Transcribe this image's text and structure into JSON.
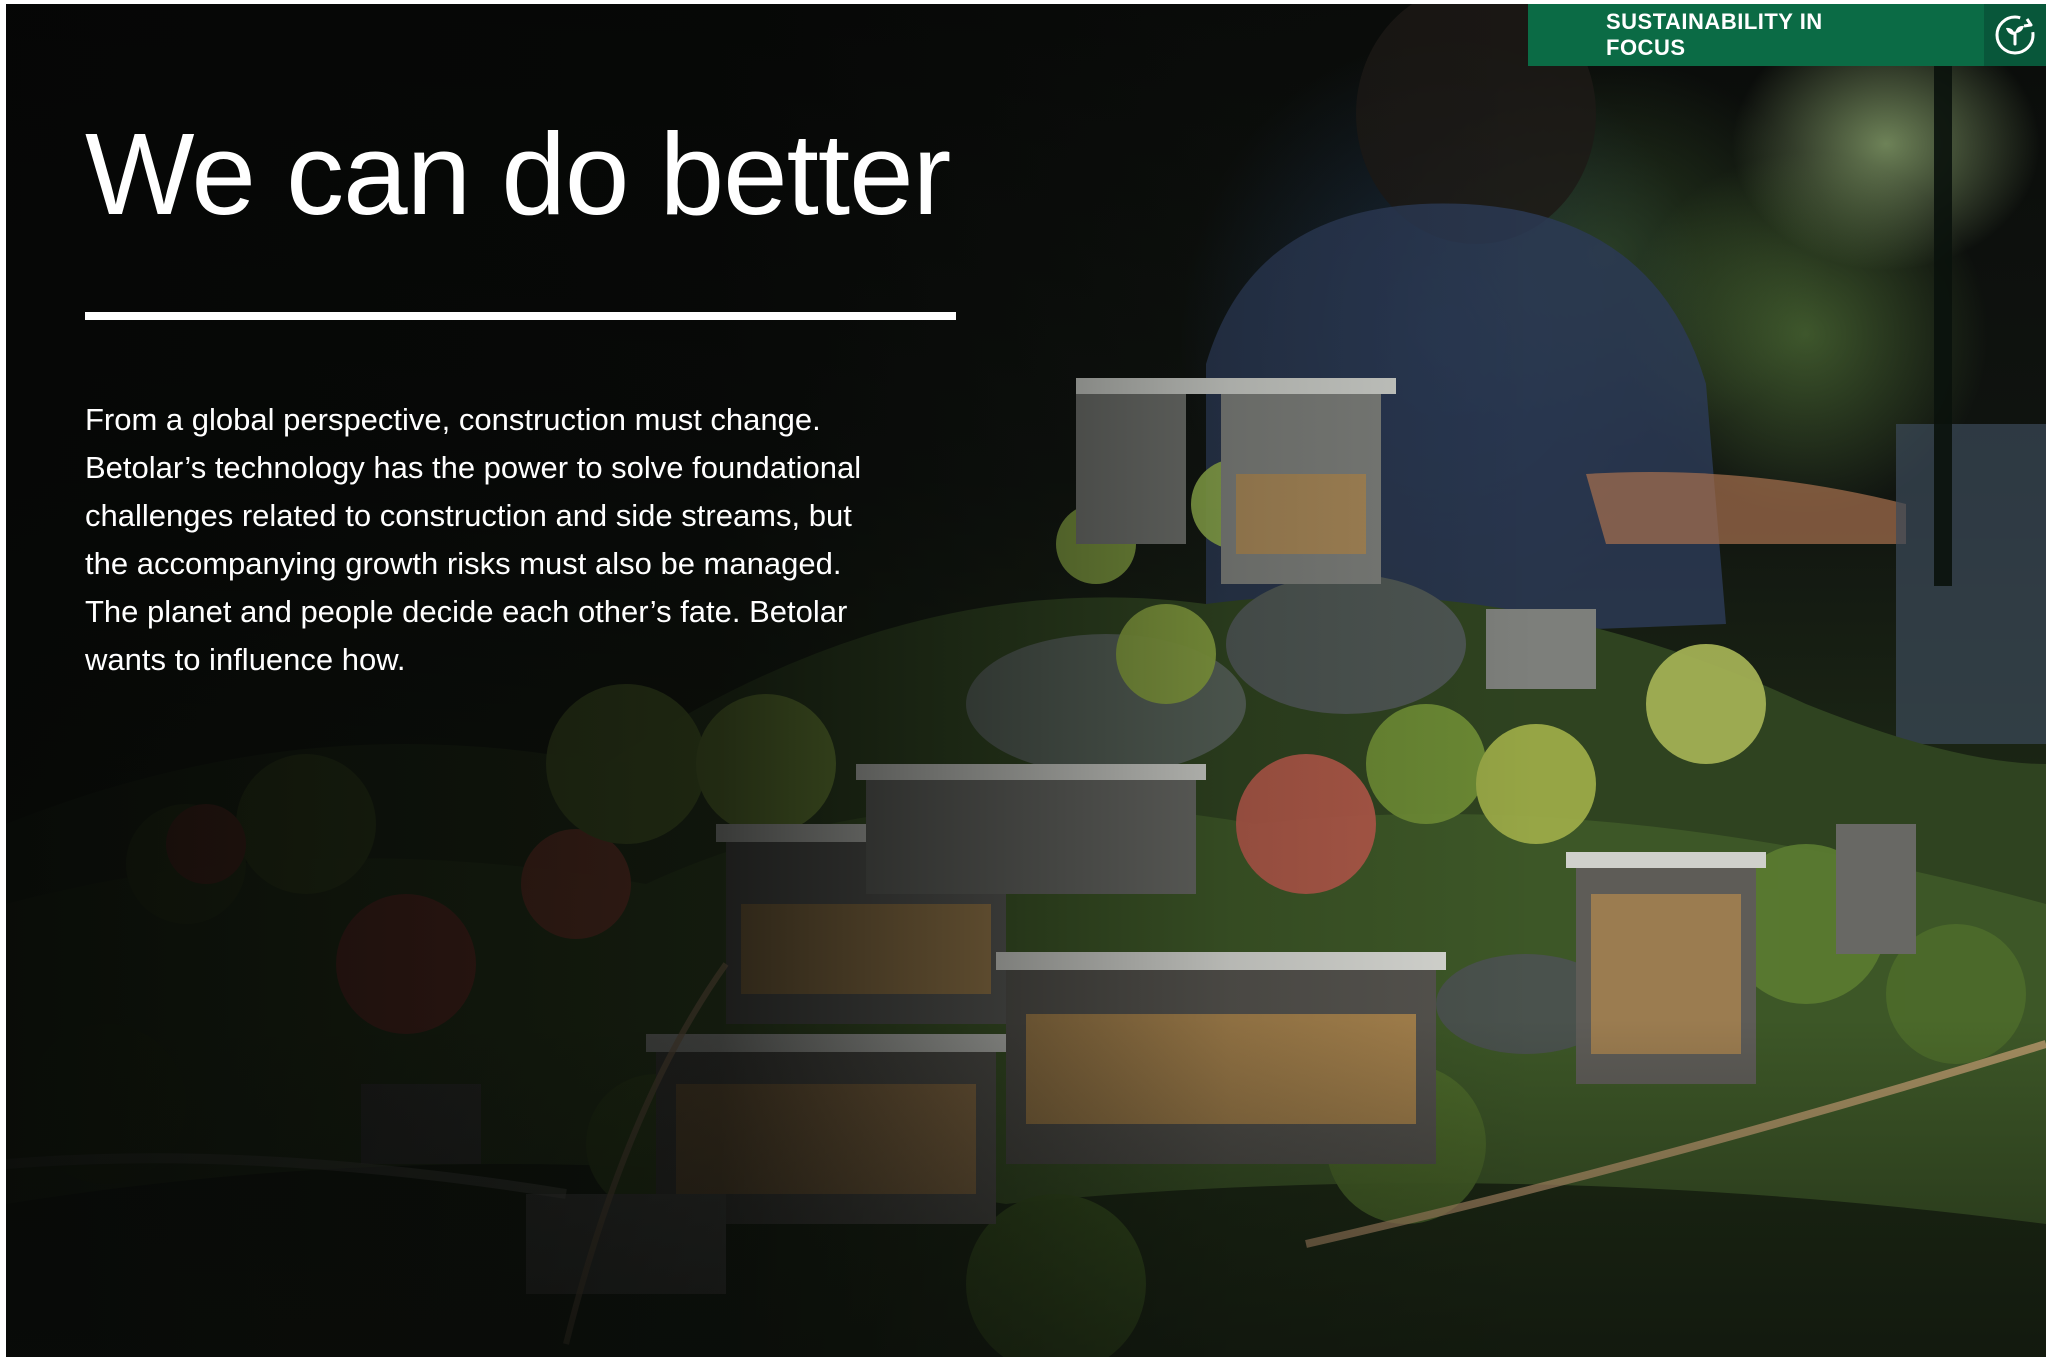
{
  "badge": {
    "label": "SUSTAINABILITY IN FOCUS",
    "icon": "recycle-leaf-icon",
    "color": "#0b6b45"
  },
  "article": {
    "title": "We can do better",
    "body_lines": [
      "From a global perspective, construction must change.",
      "Betolar’s technology has the power to solve foundational",
      "challenges related to construction and side streams, but",
      "the accompanying growth risks must also be managed.",
      "The planet and people decide each other’s fate. Betolar",
      "wants to influence how."
    ]
  },
  "image": {
    "subject": "architectural-model-photo"
  }
}
